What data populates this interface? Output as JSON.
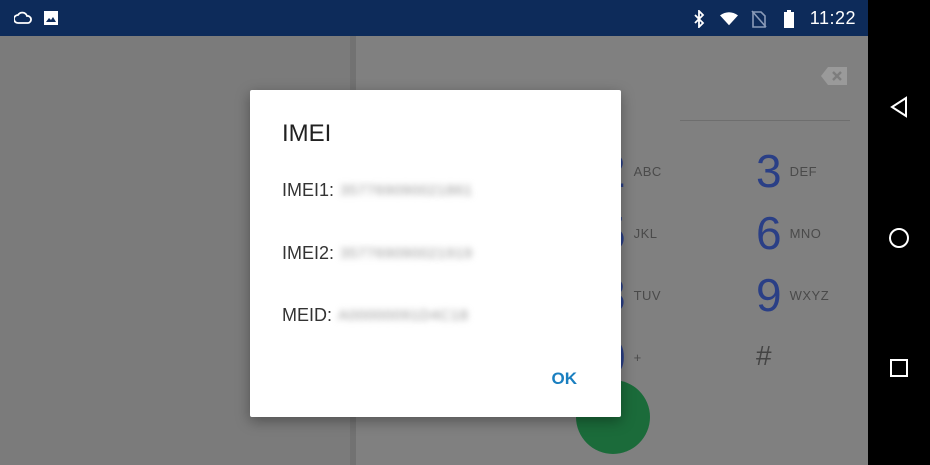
{
  "status_bar": {
    "left_icons": [
      "cloud-sync-icon",
      "image-icon"
    ],
    "right_icons": [
      "bluetooth-icon",
      "wifi-icon",
      "no-sim-icon",
      "battery-icon"
    ],
    "time": "11:22"
  },
  "nav_bar": {
    "buttons": [
      "back-icon",
      "home-icon",
      "recents-icon"
    ]
  },
  "dialer": {
    "keys": [
      {
        "num": "2",
        "letters": "ABC"
      },
      {
        "num": "3",
        "letters": "DEF"
      },
      {
        "num": "5",
        "letters": "JKL"
      },
      {
        "num": "6",
        "letters": "MNO"
      },
      {
        "num": "8",
        "letters": "TUV"
      },
      {
        "num": "9",
        "letters": "WXYZ"
      },
      {
        "num": "0",
        "letters": "+"
      },
      {
        "num": "#",
        "letters": ""
      }
    ]
  },
  "dialog": {
    "title": "IMEI",
    "rows": [
      {
        "label": "IMEI1:",
        "value": "357769090021861"
      },
      {
        "label": "IMEI2:",
        "value": "357769090021919"
      },
      {
        "label": "MEID:",
        "value": "A00000091D4C18"
      }
    ],
    "ok_label": "OK"
  },
  "colors": {
    "status_bar_bg": "#0d2b5a",
    "accent": "#1a7fc0",
    "dialpad_digit": "#2a3f86",
    "call_button": "#1b6b3a"
  }
}
